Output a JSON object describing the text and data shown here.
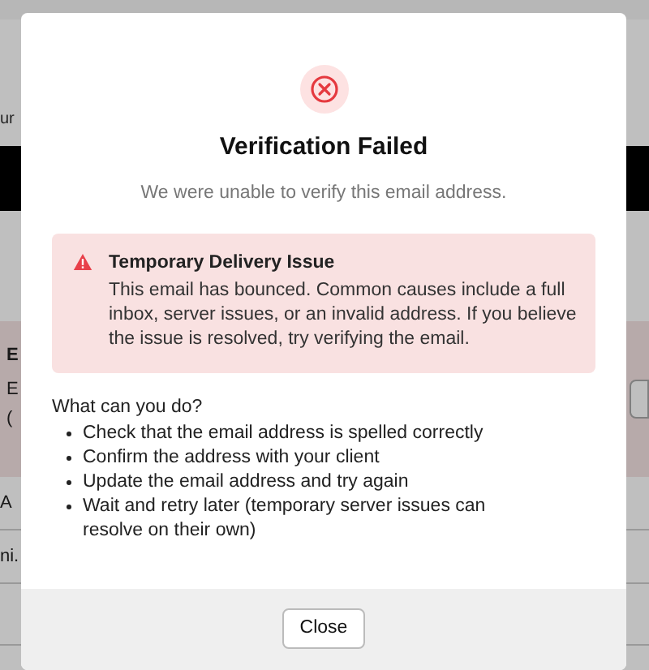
{
  "background_page": {
    "subtitle_fragment": "ur",
    "alert_fragments": [
      "E",
      "E",
      "("
    ],
    "rows": [
      "A",
      "ni."
    ]
  },
  "dialog": {
    "title": "Verification Failed",
    "subtitle": "We were unable to verify this email address.",
    "alert": {
      "title": "Temporary Delivery Issue",
      "body": "This email has bounced. Common causes include a full inbox, server issues, or an invalid address. If you believe the issue is resolved, try verifying the email."
    },
    "suggestions_heading": "What can you do?",
    "suggestions": [
      "Check that the email address is spelled correctly",
      "Confirm the address with your client",
      "Update the email address and try again",
      "Wait and retry later (temporary server issues can resolve on their own)"
    ],
    "buttons": [
      "Close"
    ]
  }
}
